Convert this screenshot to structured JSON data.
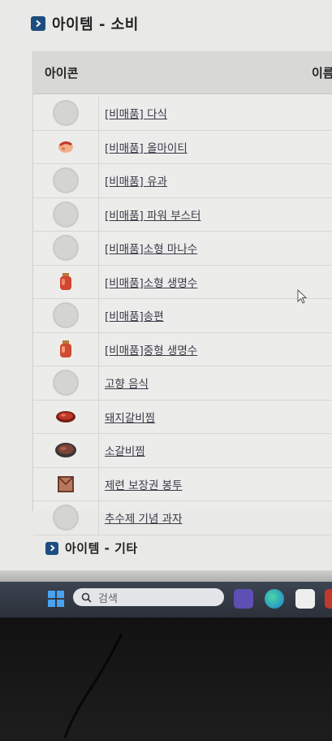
{
  "sections": {
    "consumables": {
      "title": "아이템 - 소비",
      "chevron_icon": "chevron-right-icon"
    },
    "other": {
      "title": "아이템 - 기타",
      "chevron_icon": "chevron-right-icon"
    }
  },
  "table": {
    "headers": {
      "icon": "아이콘",
      "name": "이름"
    },
    "rows": [
      {
        "name": "[비매품] 다식",
        "icon": "no-image-placeholder-icon"
      },
      {
        "name": "[비매품] 올마이티",
        "icon": "hand-item-icon"
      },
      {
        "name": "[비매품] 유과",
        "icon": "no-image-placeholder-icon"
      },
      {
        "name": "[비매품] 파워 부스터",
        "icon": "no-image-placeholder-icon"
      },
      {
        "name": "[비매품]소형 마나수",
        "icon": "no-image-placeholder-icon"
      },
      {
        "name": "[비매품]소형 생명수",
        "icon": "red-potion-icon"
      },
      {
        "name": "[비매품]송편",
        "icon": "no-image-placeholder-icon"
      },
      {
        "name": "[비매품]중형 생명수",
        "icon": "red-potion-icon"
      },
      {
        "name": "고향 음식",
        "icon": "no-image-placeholder-icon"
      },
      {
        "name": "돼지갈비찜",
        "icon": "braised-pork-ribs-icon"
      },
      {
        "name": "소갈비찜",
        "icon": "braised-beef-ribs-icon"
      },
      {
        "name": "제련 보장권 봉투",
        "icon": "envelope-icon"
      },
      {
        "name": "추수제 기념 과자",
        "icon": "no-image-placeholder-icon"
      }
    ]
  },
  "taskbar": {
    "search_placeholder": "검색",
    "apps": [
      "start-icon",
      "meet-icon",
      "edge-icon",
      "store-icon",
      "app-icon"
    ]
  },
  "colors": {
    "accent": "#1c4d80",
    "link_text": "#3a3a48",
    "taskbar": "#2f3540"
  }
}
